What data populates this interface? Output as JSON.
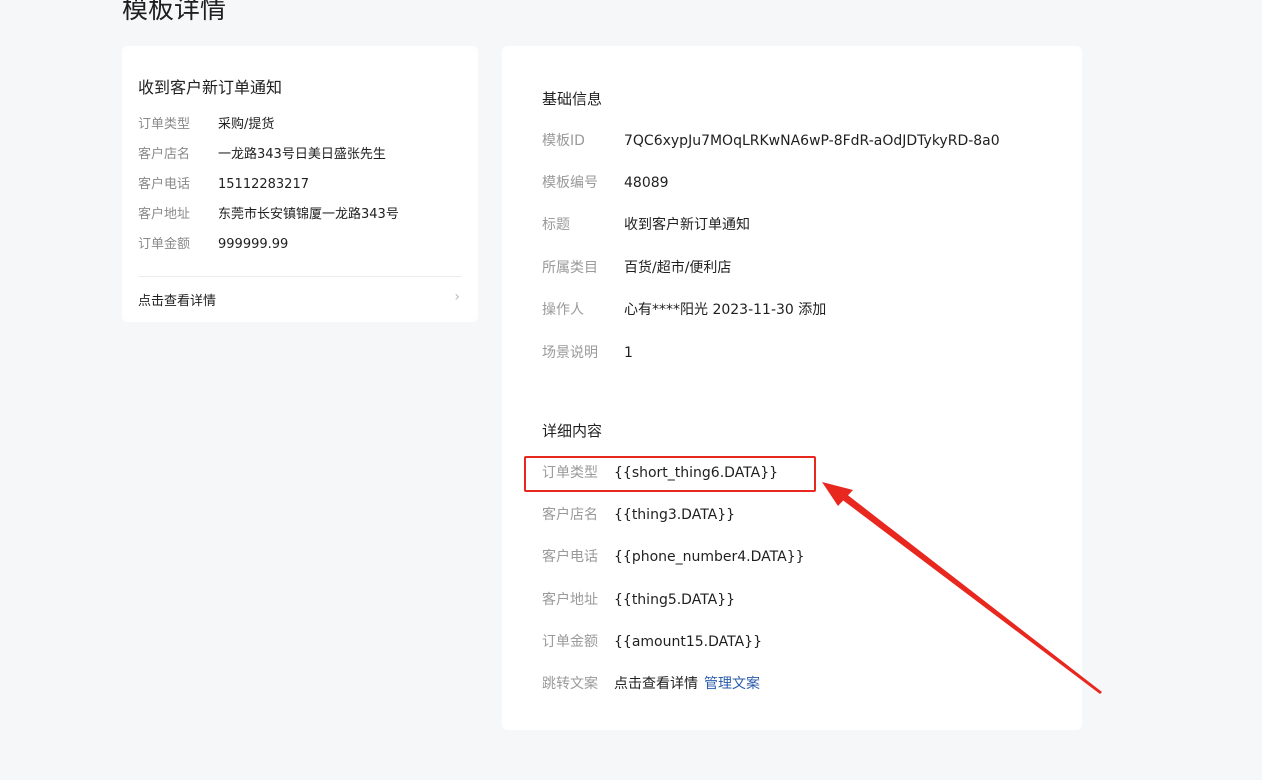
{
  "page": {
    "title": "模板详情"
  },
  "preview": {
    "title": "收到客户新订单通知",
    "rows": [
      {
        "key": "订单类型",
        "value": "采购/提货"
      },
      {
        "key": "客户店名",
        "value": "一龙路343号日美日盛张先生"
      },
      {
        "key": "客户电话",
        "value": "15112283217"
      },
      {
        "key": "客户地址",
        "value": "东莞市长安镇锦厦一龙路343号"
      },
      {
        "key": "订单金额",
        "value": "999999.99"
      }
    ],
    "link_label": "点击查看详情",
    "link_icon": "chevron-right-icon"
  },
  "basic_info": {
    "title": "基础信息",
    "rows": [
      {
        "key": "模板ID",
        "value": "7QC6xypJu7MOqLRKwNA6wP-8FdR-aOdJDTykyRD-8a0"
      },
      {
        "key": "模板编号",
        "value": "48089"
      },
      {
        "key": "标题",
        "value": "收到客户新订单通知"
      },
      {
        "key": "所属类目",
        "value": "百货/超市/便利店"
      },
      {
        "key": "操作人",
        "value": "心有****阳光 2023-11-30 添加"
      },
      {
        "key": "场景说明",
        "value": "1"
      }
    ]
  },
  "detail_content": {
    "title": "详细内容",
    "rows": [
      {
        "key": "订单类型",
        "value": "{{short_thing6.DATA}}"
      },
      {
        "key": "客户店名",
        "value": "{{thing3.DATA}}"
      },
      {
        "key": "客户电话",
        "value": "{{phone_number4.DATA}}"
      },
      {
        "key": "客户地址",
        "value": "{{thing5.DATA}}"
      },
      {
        "key": "订单金额",
        "value": "{{amount15.DATA}}"
      }
    ],
    "jump": {
      "key": "跳转文案",
      "value": "点击查看详情",
      "manage_label": "管理文案"
    }
  },
  "annotation": {
    "color": "#e8271f",
    "highlighted_row": "订单类型"
  }
}
